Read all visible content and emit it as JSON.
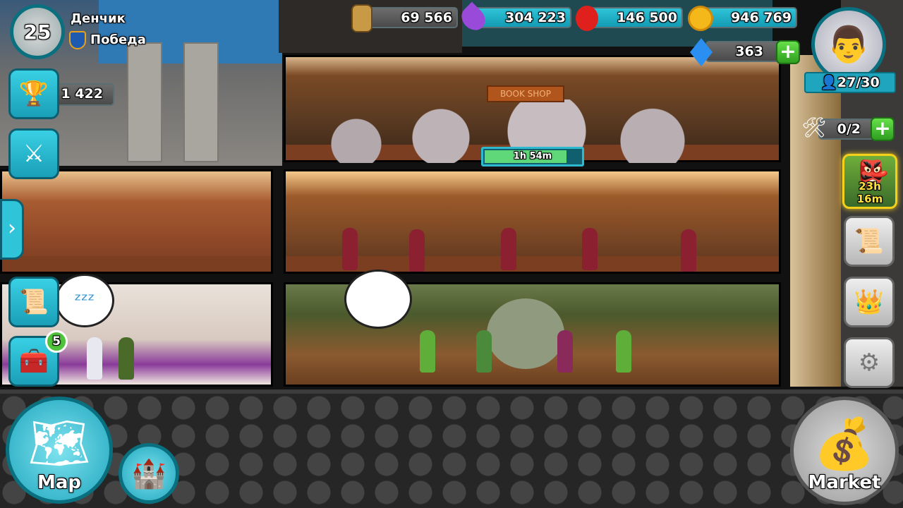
{
  "player": {
    "name": "Денчик",
    "level": "25",
    "guild": "Победа",
    "trophies": "1 422"
  },
  "resources": {
    "wood": "69 566",
    "mana": "304 223",
    "food": "146 500",
    "gold": "946 769",
    "gems": "363"
  },
  "population": "27/30",
  "builders": "0/2",
  "rooms": {
    "bookshop_sign": "BOOK SHOP",
    "build_timer": "1h 54m",
    "build_progress_percent": 83
  },
  "event": {
    "timer": "23h 16m"
  },
  "chest_badge": "5",
  "nav": {
    "map": "Map",
    "market": "Market"
  },
  "colors": {
    "accent": "#1fb5cc",
    "plus": "#3fbf2a",
    "timer_fill": "#5fd87a"
  }
}
